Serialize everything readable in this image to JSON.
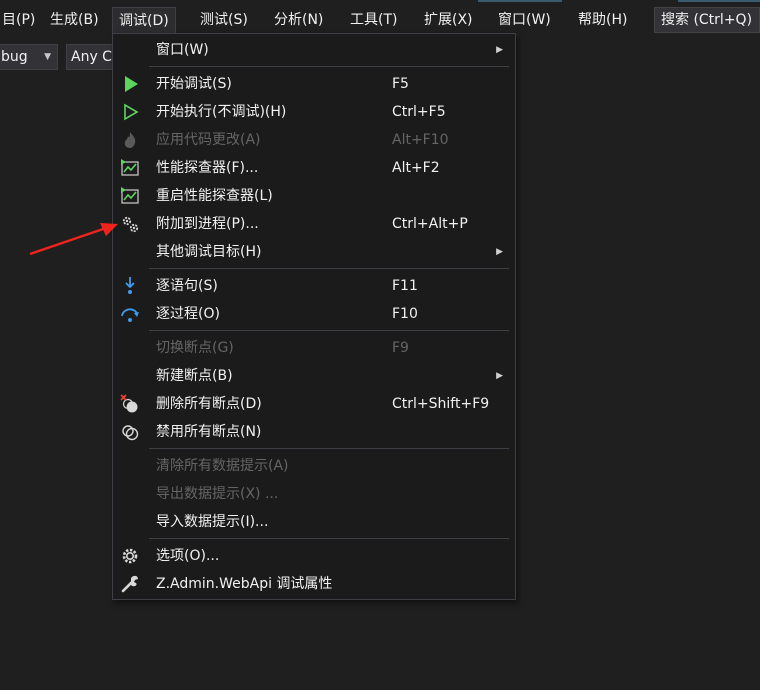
{
  "menubar": {
    "items": [
      {
        "label": "目(P)"
      },
      {
        "label": "生成(B)"
      },
      {
        "label": "调试(D)"
      },
      {
        "label": "测试(S)"
      },
      {
        "label": "分析(N)"
      },
      {
        "label": "工具(T)"
      },
      {
        "label": "扩展(X)"
      },
      {
        "label": "窗口(W)"
      },
      {
        "label": "帮助(H)"
      }
    ],
    "search_label": "搜索 (Ctrl+Q)"
  },
  "toolbar": {
    "config_value": "bug",
    "platform_value": "Any C"
  },
  "menu": {
    "items": [
      {
        "label": "窗口(W)",
        "shortcut": "",
        "submenu": true,
        "enabled": true,
        "icon": "none"
      },
      {
        "label": "开始调试(S)",
        "shortcut": "F5",
        "submenu": false,
        "enabled": true,
        "icon": "play-filled-icon"
      },
      {
        "label": "开始执行(不调试)(H)",
        "shortcut": "Ctrl+F5",
        "submenu": false,
        "enabled": true,
        "icon": "play-outline-icon"
      },
      {
        "label": "应用代码更改(A)",
        "shortcut": "Alt+F10",
        "submenu": false,
        "enabled": false,
        "icon": "flame-icon"
      },
      {
        "label": "性能探查器(F)...",
        "shortcut": "Alt+F2",
        "submenu": false,
        "enabled": true,
        "icon": "performance-chart-icon"
      },
      {
        "label": "重启性能探查器(L)",
        "shortcut": "",
        "submenu": false,
        "enabled": true,
        "icon": "performance-chart-icon"
      },
      {
        "label": "附加到进程(P)...",
        "shortcut": "Ctrl+Alt+P",
        "submenu": false,
        "enabled": true,
        "icon": "gears-icon"
      },
      {
        "label": "其他调试目标(H)",
        "shortcut": "",
        "submenu": true,
        "enabled": true,
        "icon": "none"
      },
      {
        "label": "逐语句(S)",
        "shortcut": "F11",
        "submenu": false,
        "enabled": true,
        "icon": "step-into-icon"
      },
      {
        "label": "逐过程(O)",
        "shortcut": "F10",
        "submenu": false,
        "enabled": true,
        "icon": "step-over-icon"
      },
      {
        "label": "切换断点(G)",
        "shortcut": "F9",
        "submenu": false,
        "enabled": false,
        "icon": "none"
      },
      {
        "label": "新建断点(B)",
        "shortcut": "",
        "submenu": true,
        "enabled": true,
        "icon": "none"
      },
      {
        "label": "删除所有断点(D)",
        "shortcut": "Ctrl+Shift+F9",
        "submenu": false,
        "enabled": true,
        "icon": "delete-breakpoints-icon"
      },
      {
        "label": "禁用所有断点(N)",
        "shortcut": "",
        "submenu": false,
        "enabled": true,
        "icon": "disable-breakpoints-icon"
      },
      {
        "label": "清除所有数据提示(A)",
        "shortcut": "",
        "submenu": false,
        "enabled": false,
        "icon": "none"
      },
      {
        "label": "导出数据提示(X) ...",
        "shortcut": "",
        "submenu": false,
        "enabled": false,
        "icon": "none"
      },
      {
        "label": "导入数据提示(I)...",
        "shortcut": "",
        "submenu": false,
        "enabled": true,
        "icon": "none"
      },
      {
        "label": "选项(O)...",
        "shortcut": "",
        "submenu": false,
        "enabled": true,
        "icon": "gear-icon"
      },
      {
        "label": "Z.Admin.WebApi 调试属性",
        "shortcut": "",
        "submenu": false,
        "enabled": true,
        "icon": "wrench-icon"
      }
    ]
  },
  "colors": {
    "accent_green": "#5ed45e",
    "accent_blue": "#3f9cf0",
    "annotation_red": "#f0241c"
  }
}
